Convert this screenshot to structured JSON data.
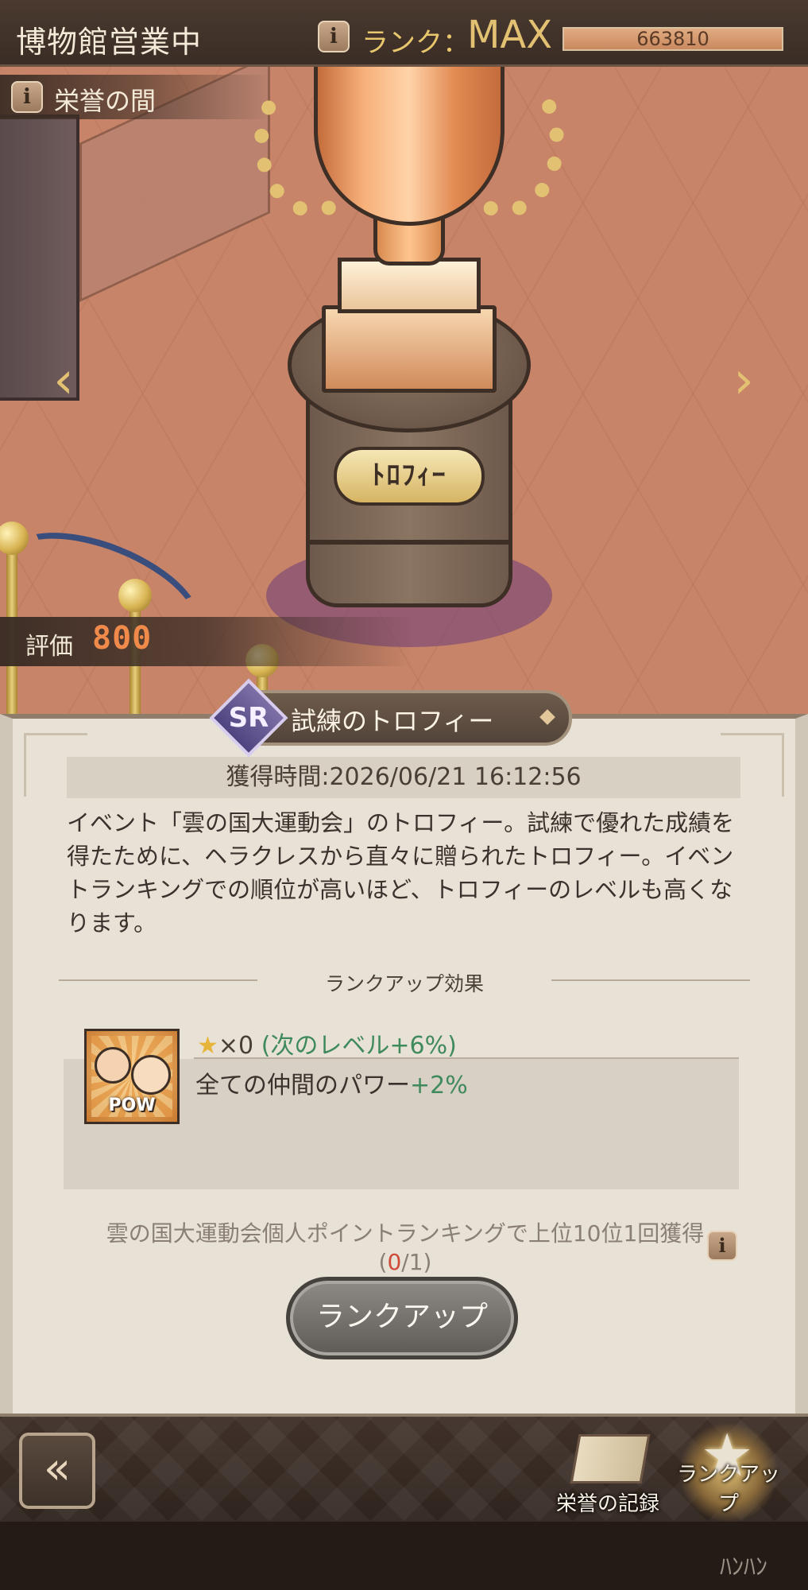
{
  "topbar": {
    "museum_status": "博物館営業中",
    "rank_label": "ランク：",
    "rank_value": "MAX",
    "rank_points": "663810",
    "rank_progress": 1.0
  },
  "scene": {
    "section_label": "栄誉の間",
    "plaque_text": "ﾄﾛﾌｨｰ",
    "rating_label": "評価",
    "rating_value": "800"
  },
  "trophy": {
    "rarity": "SR",
    "name": "試練のトロフィー",
    "acquired": "獲得時間:2026/06/21 16:12:56",
    "description": "イベント「雲の国大運動会」のトロフィー。試練で優れた成績を得たために、ヘラクレスから直々に贈られたトロフィー。イベントランキングでの順位が高いほど、トロフィーのレベルも高くなります。"
  },
  "effects": {
    "section_title": "ランクアップ効果",
    "icon_label": "POW",
    "star_count": "×0",
    "next_level": "(次のレベル+6%)",
    "effect_text": "全ての仲間のパワー",
    "effect_bonus": "+2%"
  },
  "condition": {
    "text": "雲の国大運動会個人ポイントランキングで上位10位1回獲得",
    "progress_open": "(",
    "progress_current": "0",
    "progress_rest": "/1)"
  },
  "buttons": {
    "rankup": "ランクアップ",
    "record_label": "栄誉の記録",
    "rankup_menu_label": "ランクアップ"
  },
  "watermark": "ﾊﾝﾊﾝ",
  "colors": {
    "accent_gold": "#e2c172",
    "bonus_green": "#3f8a5c",
    "condition_red": "#d04a3a",
    "rating_orange": "#f08a4a",
    "rarity_purple": "#5f5290"
  },
  "icons": {
    "info": "info-icon",
    "nav_left": "chevron-left-icon",
    "nav_right": "chevron-right-icon",
    "back": "back-double-chevron-icon",
    "star": "star-icon",
    "record": "book-icon",
    "rankup_menu": "star-arrow-icon"
  }
}
